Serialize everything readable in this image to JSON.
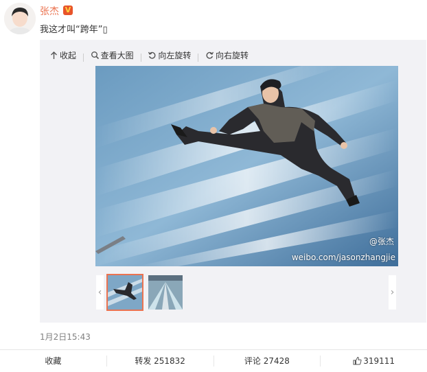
{
  "post": {
    "author": "张杰",
    "verified_badge": "V",
    "text": "我这才叫“跨年”▯",
    "timestamp": "1月2日15:43"
  },
  "toolbar": {
    "collapse": "收起",
    "view_large": "查看大图",
    "rotate_left": "向左旋转",
    "rotate_right": "向右旋转",
    "icons": [
      "collapse-up-icon",
      "magnifier-icon",
      "rotate-left-icon",
      "rotate-right-icon"
    ]
  },
  "photo": {
    "watermark_handle": "@张杰",
    "watermark_url": "weibo.com/jasonzhangjie"
  },
  "carousel": {
    "prev": "‹",
    "next": "›",
    "selected_index": 0
  },
  "actions": {
    "favorite": "收藏",
    "repost": "转发 251832",
    "comment": "评论 27428",
    "like": "319111"
  },
  "colors": {
    "accent": "#eb7350",
    "media_bg": "#f2f2f5",
    "muted": "#808080"
  }
}
